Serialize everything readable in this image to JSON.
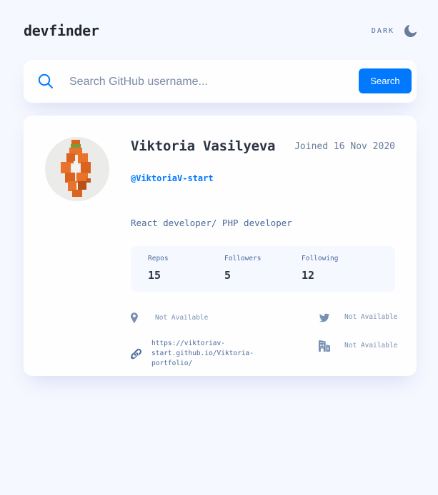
{
  "header": {
    "logo": "devfinder",
    "theme_label": "DARK",
    "theme_icon": "moon-icon"
  },
  "search": {
    "placeholder": "Search GitHub username...",
    "button_label": "Search",
    "icon": "search-icon"
  },
  "profile": {
    "name": "Viktoria Vasilyeva",
    "joined": "Joined 16 Nov 2020",
    "login": "@ViktoriaV-start",
    "bio": "React developer/ PHP developer",
    "stats": [
      {
        "label": "Repos",
        "value": "15"
      },
      {
        "label": "Followers",
        "value": "5"
      },
      {
        "label": "Following",
        "value": "12"
      }
    ],
    "links": {
      "location": "Not Available",
      "twitter": "Not Available",
      "blog": "https://viktoriav-start.github.io/Viktoria-portfolio/",
      "company": "Not Available"
    }
  },
  "colors": {
    "accent": "#0079ff",
    "background": "#f6f8ff",
    "card": "#fefefe",
    "text": "#2b3442",
    "muted": "#4b6a9b"
  }
}
